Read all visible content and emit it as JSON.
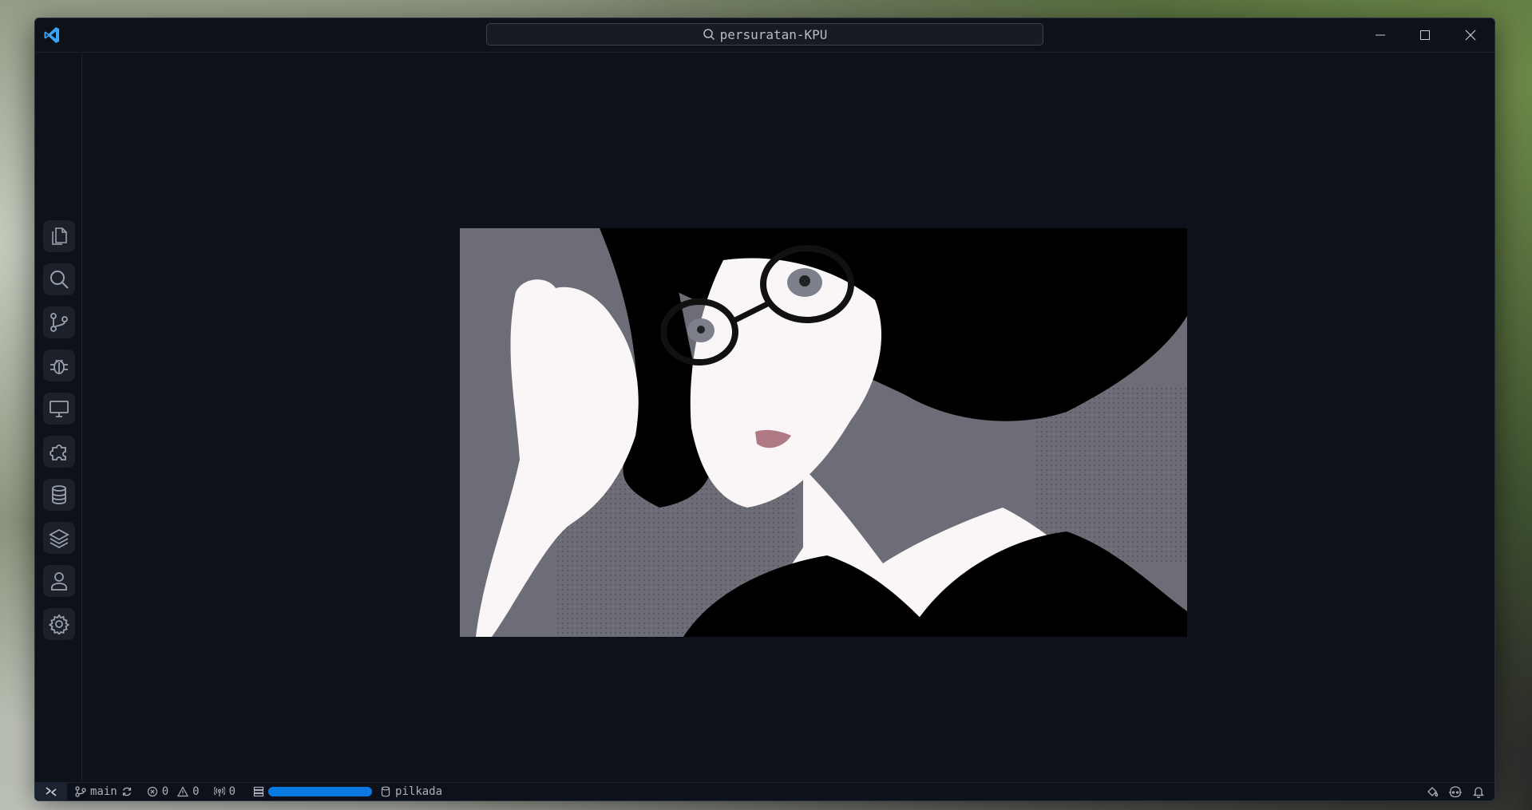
{
  "titlebar": {
    "search_text": "persuratan-KPU",
    "logo_icon": "vscode-logo-icon",
    "controls": [
      "minimize-icon",
      "maximize-icon",
      "close-icon"
    ]
  },
  "activitybar": {
    "items": [
      {
        "name": "explorer",
        "icon": "files-icon"
      },
      {
        "name": "search",
        "icon": "search-icon"
      },
      {
        "name": "source-control",
        "icon": "source-control-icon"
      },
      {
        "name": "run-debug",
        "icon": "bug-icon"
      },
      {
        "name": "remote-explorer",
        "icon": "monitor-icon"
      },
      {
        "name": "extensions",
        "icon": "puzzle-icon"
      },
      {
        "name": "database",
        "icon": "database-icon"
      },
      {
        "name": "layers",
        "icon": "layers-icon"
      }
    ],
    "bottom": [
      {
        "name": "accounts",
        "icon": "account-icon"
      },
      {
        "name": "manage",
        "icon": "gear-icon"
      }
    ]
  },
  "statusbar": {
    "branch": "main",
    "errors": "0",
    "warnings": "0",
    "ports": "0",
    "database": "pilkada"
  },
  "colors": {
    "background": "#0d111a",
    "accent": "#0a79e0",
    "logo": "#3ba3f5"
  }
}
